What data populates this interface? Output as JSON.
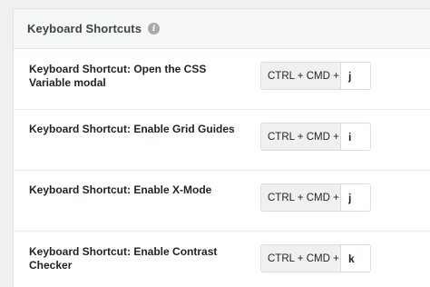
{
  "panel": {
    "title": "Keyboard Shortcuts",
    "info_icon": "info-icon"
  },
  "shortcuts": [
    {
      "label": "Keyboard Shortcut: Open the CSS Variable modal",
      "prefix": "CTRL + CMD +",
      "key": "j"
    },
    {
      "label": "Keyboard Shortcut: Enable Grid Guides",
      "prefix": "CTRL + CMD +",
      "key": "i"
    },
    {
      "label": "Keyboard Shortcut: Enable X-Mode",
      "prefix": "CTRL + CMD +",
      "key": "j"
    },
    {
      "label": "Keyboard Shortcut: Enable Contrast Checker",
      "prefix": "CTRL + CMD +",
      "key": "k"
    }
  ]
}
